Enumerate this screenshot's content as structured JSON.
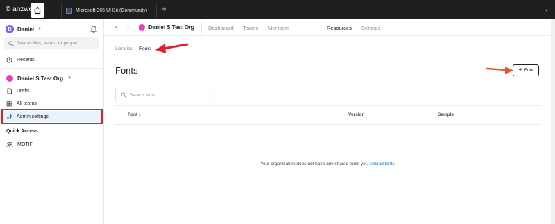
{
  "tab_bar": {
    "watermark": "© anzweb.ir",
    "file_tab_label": "Microsoft 365 UI Kit (Community)",
    "new_tab_glyph": "+",
    "overflow_glyph": "⌄"
  },
  "sidebar": {
    "user": {
      "initial": "D",
      "name": "Daniel"
    },
    "search_placeholder": "Search files, teams, or people",
    "recents": "Recents",
    "org_name": "Daniel S Test Org",
    "items": [
      {
        "label": "Drafts",
        "icon": "file-icon"
      },
      {
        "label": "All teams",
        "icon": "grid-icon"
      },
      {
        "label": "Admin settings",
        "icon": "sliders-icon",
        "selected": true
      }
    ],
    "quick_access_label": "Quick Access",
    "quick_access_items": [
      {
        "label": "MOTIF",
        "icon": "people-icon"
      }
    ]
  },
  "topnav": {
    "back": "‹",
    "forward": "›",
    "org_name": "Daniel S Test Org",
    "tabs": [
      "Dashboard",
      "Teams",
      "Members",
      "Resources",
      "Settings"
    ],
    "active_tab": "Resources"
  },
  "breadcrumb": {
    "parent": "Libraries",
    "current": "Fonts"
  },
  "page_title": "Fonts",
  "add_button": {
    "icon": "+",
    "label": "Font"
  },
  "font_search_placeholder": "Search fonts...",
  "table": {
    "columns": [
      "Font",
      "Version",
      "Sample"
    ],
    "sort_icon": "↓"
  },
  "empty_state": {
    "message": "Your organization does not have any shared fonts yet.",
    "link": "Upload fonts"
  },
  "colors": {
    "annotation_red": "#d9232e",
    "selected_bg": "#e8f2fd",
    "link": "#1a76d2",
    "user_avatar": "#7b61ff",
    "org_avatar": "#e040c8"
  }
}
